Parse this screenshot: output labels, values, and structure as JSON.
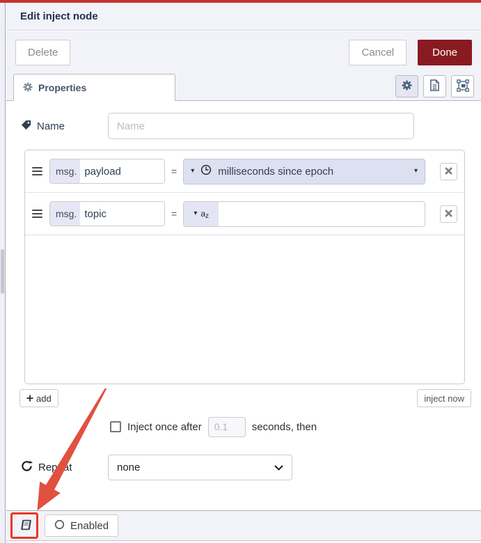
{
  "header": {
    "title": "Edit inject node"
  },
  "actions": {
    "delete": "Delete",
    "cancel": "Cancel",
    "done": "Done"
  },
  "tabs": {
    "properties": "Properties"
  },
  "name_field": {
    "label": "Name",
    "placeholder": "Name"
  },
  "props": {
    "rows": [
      {
        "prefix": "msg.",
        "property": "payload",
        "operator": "=",
        "type": "timestamp",
        "value": "milliseconds since epoch"
      },
      {
        "prefix": "msg.",
        "property": "topic",
        "operator": "=",
        "type": "string",
        "value": ""
      }
    ],
    "add_label": "add",
    "inject_now_label": "inject now"
  },
  "once": {
    "label": "Inject once after",
    "seconds_value": "0.1",
    "suffix": "seconds, then"
  },
  "repeat": {
    "label": "Repeat",
    "value": "none"
  },
  "footer": {
    "enabled_label": "Enabled"
  },
  "icons": {
    "caret_down": "▾",
    "az_a": "a",
    "az_z": "z",
    "tab_icon": "gear",
    "tool_buttons": [
      "gear",
      "document",
      "appearance"
    ],
    "name_icon": "tag",
    "payload_type_icon": "clock",
    "repeat_icon": "refresh",
    "footer_icon": "book",
    "enabled_icon": "circle"
  },
  "colors": {
    "primary_button": "#8a1a22",
    "top_bar": "#c5362f",
    "panel_bg": "#f2f2f9",
    "typed_input_bg": "#dde0f1",
    "annotation_red": "#e2503f"
  }
}
